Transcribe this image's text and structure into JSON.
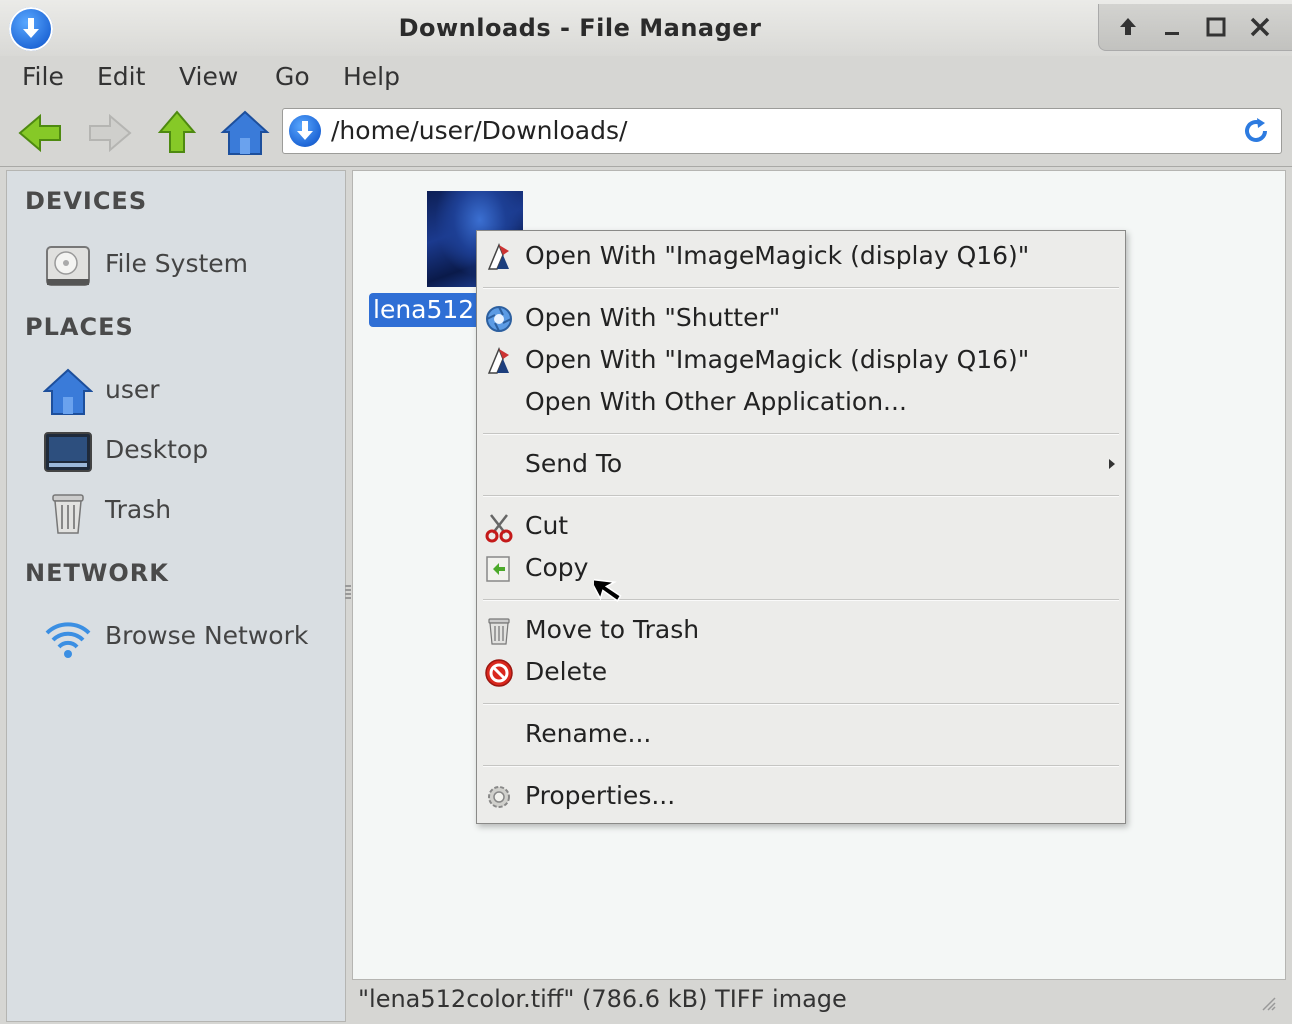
{
  "window": {
    "title": "Downloads - File Manager"
  },
  "menubar": {
    "items": [
      "File",
      "Edit",
      "View",
      "Go",
      "Help"
    ]
  },
  "toolbar": {
    "location": "/home/user/Downloads/"
  },
  "sidebar": {
    "devices_heading": "DEVICES",
    "places_heading": "PLACES",
    "network_heading": "NETWORK",
    "devices": [
      {
        "label": "File System",
        "icon": "harddisk-icon"
      }
    ],
    "places": [
      {
        "label": "user",
        "icon": "home-icon"
      },
      {
        "label": "Desktop",
        "icon": "desktop-icon"
      },
      {
        "label": "Trash",
        "icon": "trash-icon"
      }
    ],
    "network": [
      {
        "label": "Browse Network",
        "icon": "wifi-icon"
      }
    ]
  },
  "content": {
    "file_label": "lena512"
  },
  "context_menu": {
    "items": [
      {
        "label": "Open With \"ImageMagick (display Q16)\"",
        "icon": "imagemagick-icon"
      },
      {
        "label": "Open With \"Shutter\"",
        "icon": "shutter-icon"
      },
      {
        "label": "Open With \"ImageMagick (display Q16)\"",
        "icon": "imagemagick-icon"
      },
      {
        "label": "Open With Other Application...",
        "icon": ""
      },
      {
        "label": "Send To",
        "icon": ""
      },
      {
        "label": "Cut",
        "icon": "scissors-icon"
      },
      {
        "label": "Copy",
        "icon": "copy-icon"
      },
      {
        "label": "Move to Trash",
        "icon": "trash-icon"
      },
      {
        "label": "Delete",
        "icon": "delete-icon"
      },
      {
        "label": "Rename...",
        "icon": ""
      },
      {
        "label": "Properties...",
        "icon": "gear-icon"
      }
    ]
  },
  "statusbar": {
    "text": "\"lena512color.tiff\" (786.6 kB) TIFF image"
  },
  "colors": {
    "selection": "#2f6fd5",
    "accent_blue": "#1e66d6",
    "nav_green": "#7dc21e"
  }
}
